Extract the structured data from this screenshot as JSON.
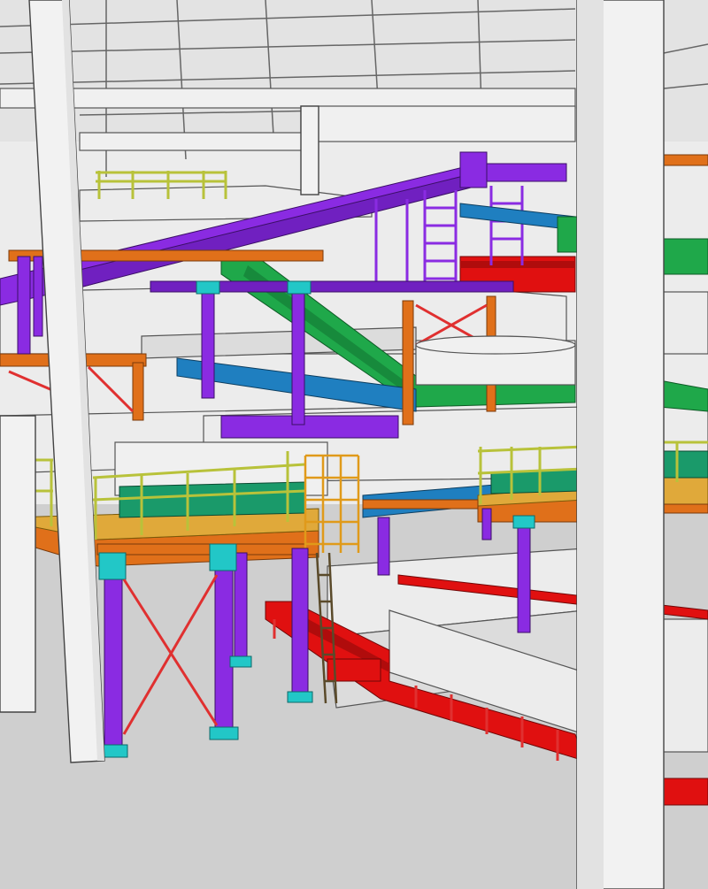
{
  "scene": {
    "subject": "industrial-plant-3d-model",
    "colors": {
      "background": "#d9d9d9",
      "floor": "#cfcfcf",
      "wall": "#ececec",
      "wall_shade": "#dcdcdc",
      "ceiling": "#e3e3e3",
      "column": "#f2f2f2",
      "outline": "#555555",
      "purple_steel": "#8a2be2",
      "green_conveyor": "#1fa84a",
      "teal_conveyor": "#1f7fc0",
      "orange_beam": "#e0701a",
      "red_conveyor": "#e01010",
      "yellow_railing": "#b8c23a",
      "cyan_plates": "#22c7c7",
      "deck_top": "#e0a93a",
      "dark_green_equipment": "#1a9a6a"
    }
  }
}
